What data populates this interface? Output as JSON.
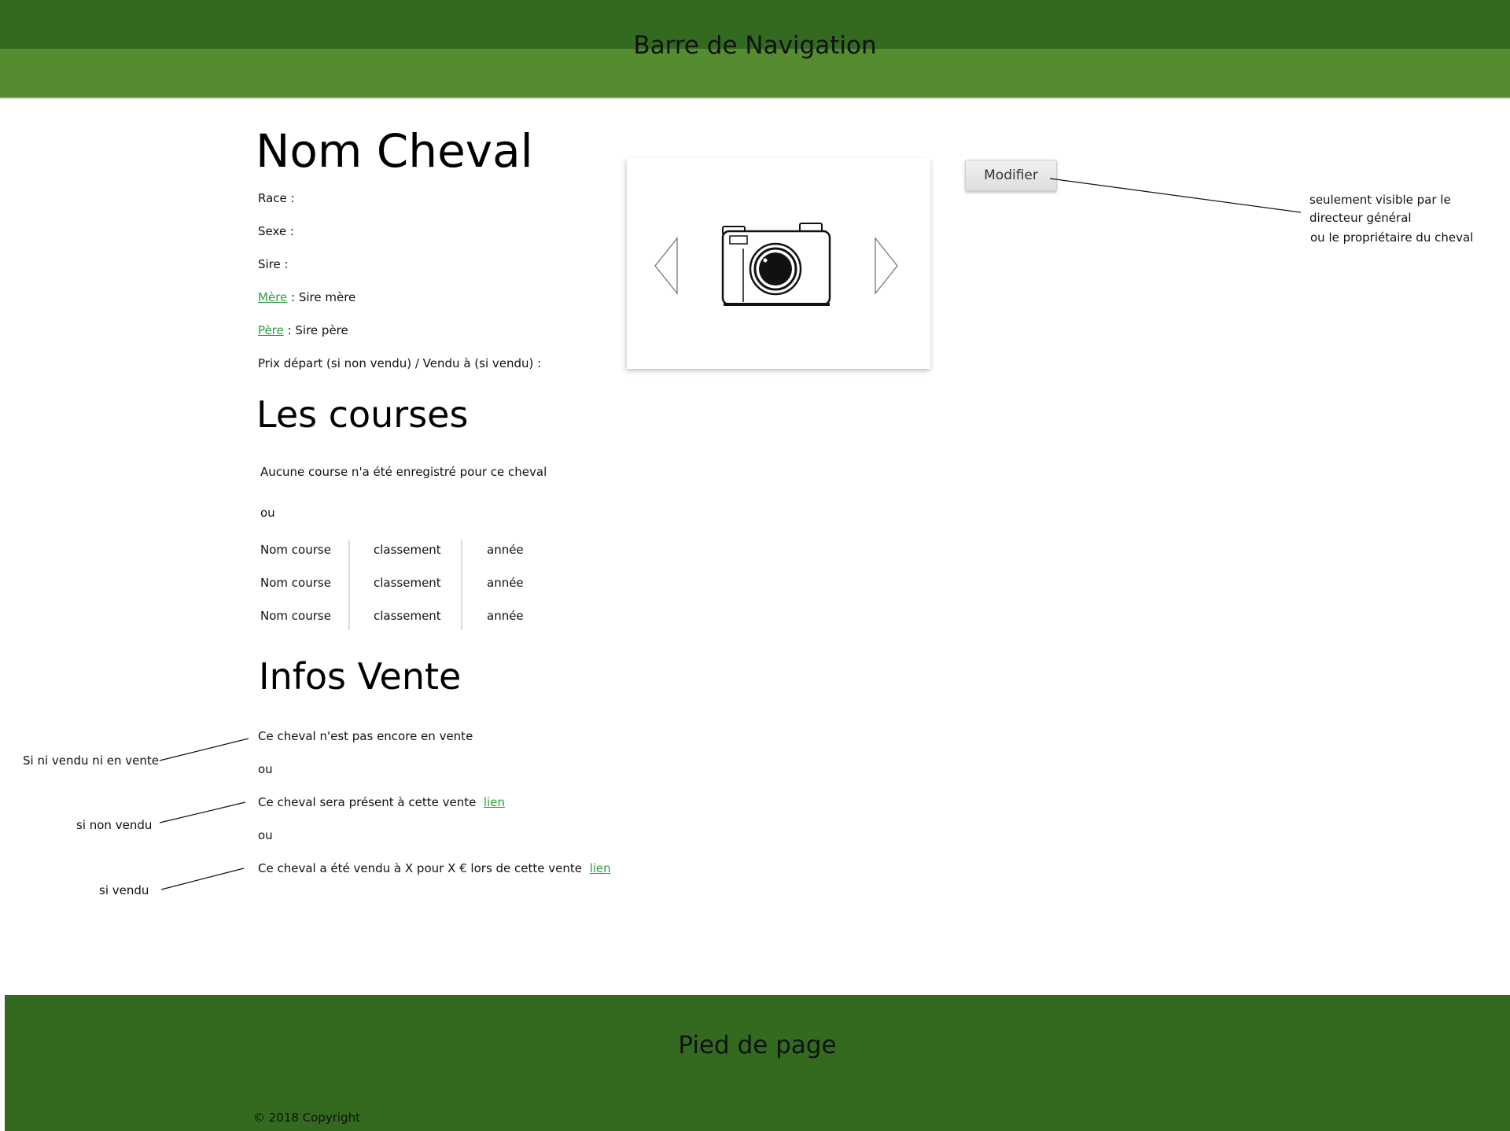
{
  "nav": {
    "title": "Barre de Navigation"
  },
  "horse": {
    "name": "Nom Cheval",
    "race_label": "Race :",
    "sexe_label": "Sexe :",
    "sire_label": "Sire :",
    "mere_link": "Mère",
    "mere_rest": " : Sire mère",
    "pere_link": "Père",
    "pere_rest": " : Sire père",
    "prix_label": "Prix départ (si non vendu) / Vendu à (si vendu) :"
  },
  "carousel": {
    "prev_icon": "chevron-left-icon",
    "next_icon": "chevron-right-icon",
    "image_icon": "camera-icon"
  },
  "modifier": {
    "button_label": "Modifier",
    "note_line1": "seulement visible par le",
    "note_line2": "directeur général",
    "note_line3": "ou le propriétaire du cheval"
  },
  "courses": {
    "title": "Les courses",
    "empty_message": "Aucune course n'a été enregistré pour ce cheval",
    "or": "ou",
    "rows": [
      [
        "Nom course",
        "classement",
        "année"
      ],
      [
        "Nom course",
        "classement",
        "année"
      ],
      [
        "Nom course",
        "classement",
        "année"
      ]
    ]
  },
  "vente": {
    "title": "Infos Vente",
    "line1": "Ce cheval n'est pas encore en vente",
    "or1": "ou",
    "line2": "Ce cheval sera présent à cette vente",
    "line2_link": "lien",
    "or2": "ou",
    "line3": "Ce cheval a été vendu à X pour X € lors de cette vente",
    "line3_link": "lien",
    "note1": "Si ni vendu ni en vente",
    "note2": "si non vendu",
    "note3": "si vendu"
  },
  "footer": {
    "title": "Pied de page",
    "copyright": "© 2018 Copyright"
  },
  "colors": {
    "nav_dark": "#336a1f",
    "nav_light": "#548c2f",
    "link": "#2e9b3e",
    "footer": "#336a1f"
  }
}
